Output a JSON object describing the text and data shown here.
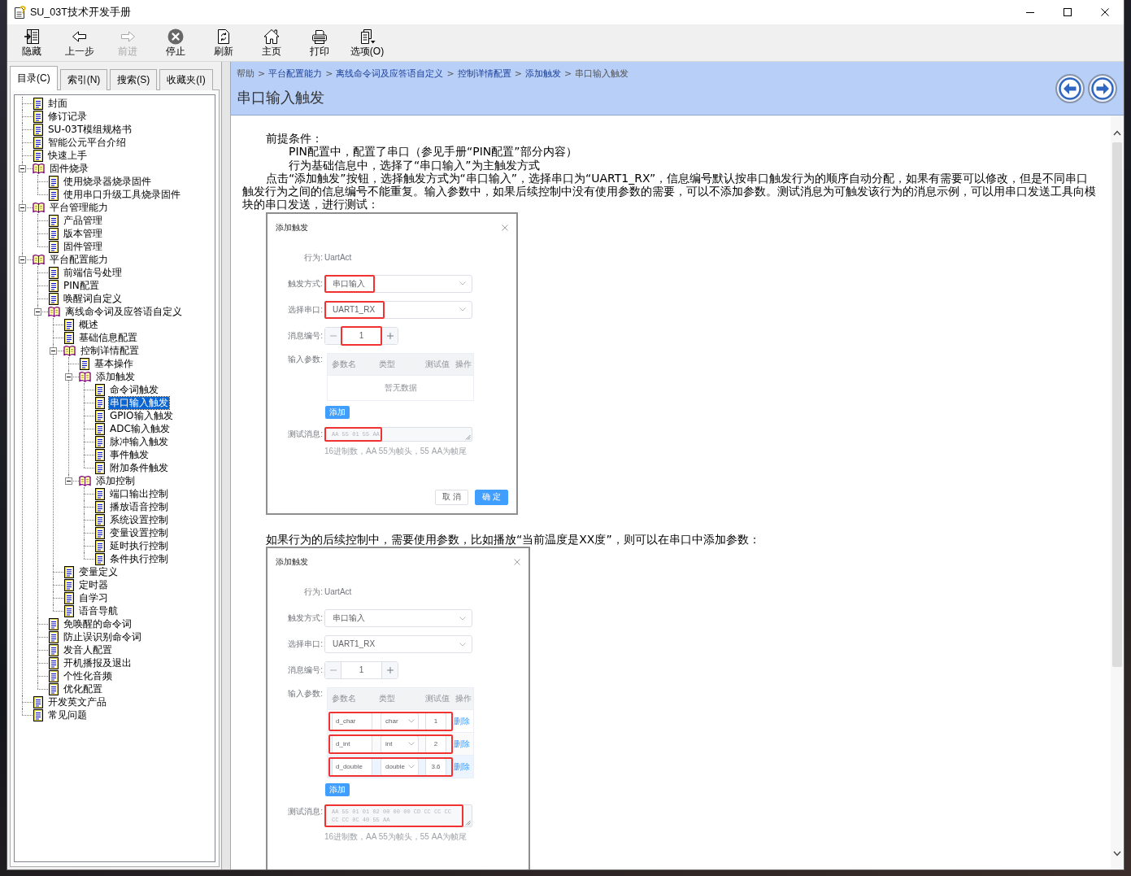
{
  "window": {
    "title": "SU_03T技术开发手册"
  },
  "toolbar": [
    {
      "kind": "hide",
      "label": "隐藏",
      "disabled": false
    },
    {
      "kind": "back",
      "label": "上一步",
      "disabled": false
    },
    {
      "kind": "forward",
      "label": "前进",
      "disabled": true
    },
    {
      "kind": "stop",
      "label": "停止",
      "disabled": false
    },
    {
      "kind": "refresh",
      "label": "刷新",
      "disabled": false
    },
    {
      "kind": "home",
      "label": "主页",
      "disabled": false
    },
    {
      "kind": "print",
      "label": "打印",
      "disabled": false
    },
    {
      "kind": "options",
      "label": "选项(O)",
      "disabled": false
    }
  ],
  "tabs": [
    {
      "label": "目录(C)",
      "selected": true
    },
    {
      "label": "索引(N)",
      "selected": false
    },
    {
      "label": "搜索(S)",
      "selected": false
    },
    {
      "label": "收藏夹(I)",
      "selected": false
    }
  ],
  "tree": [
    {
      "label": "封面",
      "kind": "page",
      "selected": false
    },
    {
      "label": "修订记录",
      "kind": "page",
      "selected": false
    },
    {
      "label": "SU-03T模组规格书",
      "kind": "page",
      "selected": false
    },
    {
      "label": "智能公元平台介绍",
      "kind": "page",
      "selected": false
    },
    {
      "label": "快速上手",
      "kind": "page",
      "selected": false
    },
    {
      "label": "固件烧录",
      "kind": "book",
      "expanded": true,
      "selected": false,
      "children": [
        {
          "label": "使用烧录器烧录固件",
          "kind": "page",
          "selected": false
        },
        {
          "label": "使用串口升级工具烧录固件",
          "kind": "page",
          "selected": false
        }
      ]
    },
    {
      "label": "平台管理能力",
      "kind": "book",
      "expanded": true,
      "selected": false,
      "children": [
        {
          "label": "产品管理",
          "kind": "page",
          "selected": false
        },
        {
          "label": "版本管理",
          "kind": "page",
          "selected": false
        },
        {
          "label": "固件管理",
          "kind": "page",
          "selected": false
        }
      ]
    },
    {
      "label": "平台配置能力",
      "kind": "book",
      "expanded": true,
      "selected": false,
      "children": [
        {
          "label": "前端信号处理",
          "kind": "page",
          "selected": false
        },
        {
          "label": "PIN配置",
          "kind": "page",
          "selected": false
        },
        {
          "label": "唤醒词自定义",
          "kind": "page",
          "selected": false
        },
        {
          "label": "离线命令词及应答语自定义",
          "kind": "book",
          "expanded": true,
          "selected": false,
          "children": [
            {
              "label": "概述",
              "kind": "page",
              "selected": false
            },
            {
              "label": "基础信息配置",
              "kind": "page",
              "selected": false
            },
            {
              "label": "控制详情配置",
              "kind": "book",
              "expanded": true,
              "selected": false,
              "children": [
                {
                  "label": "基本操作",
                  "kind": "page",
                  "selected": false
                },
                {
                  "label": "添加触发",
                  "kind": "book",
                  "expanded": true,
                  "selected": false,
                  "children": [
                    {
                      "label": "命令词触发",
                      "kind": "page",
                      "selected": false
                    },
                    {
                      "label": "串口输入触发",
                      "kind": "page",
                      "selected": true
                    },
                    {
                      "label": "GPIO输入触发",
                      "kind": "page",
                      "selected": false
                    },
                    {
                      "label": "ADC输入触发",
                      "kind": "page",
                      "selected": false
                    },
                    {
                      "label": "脉冲输入触发",
                      "kind": "page",
                      "selected": false
                    },
                    {
                      "label": "事件触发",
                      "kind": "page",
                      "selected": false
                    },
                    {
                      "label": "附加条件触发",
                      "kind": "page",
                      "selected": false
                    }
                  ]
                },
                {
                  "label": "添加控制",
                  "kind": "book",
                  "expanded": true,
                  "selected": false,
                  "children": [
                    {
                      "label": "端口输出控制",
                      "kind": "page",
                      "selected": false
                    },
                    {
                      "label": "播放语音控制",
                      "kind": "page",
                      "selected": false
                    },
                    {
                      "label": "系统设置控制",
                      "kind": "page",
                      "selected": false
                    },
                    {
                      "label": "变量设置控制",
                      "kind": "page",
                      "selected": false
                    },
                    {
                      "label": "延时执行控制",
                      "kind": "page",
                      "selected": false
                    },
                    {
                      "label": "条件执行控制",
                      "kind": "page",
                      "selected": false
                    }
                  ]
                }
              ]
            },
            {
              "label": "变量定义",
              "kind": "page",
              "selected": false
            },
            {
              "label": "定时器",
              "kind": "page",
              "selected": false
            },
            {
              "label": "自学习",
              "kind": "page",
              "selected": false
            },
            {
              "label": "语音导航",
              "kind": "page",
              "selected": false
            }
          ]
        },
        {
          "label": "免唤醒的命令词",
          "kind": "page",
          "selected": false
        },
        {
          "label": "防止误识别命令词",
          "kind": "page",
          "selected": false
        },
        {
          "label": "发音人配置",
          "kind": "page",
          "selected": false
        },
        {
          "label": "开机播报及退出",
          "kind": "page",
          "selected": false
        },
        {
          "label": "个性化音频",
          "kind": "page",
          "selected": false
        },
        {
          "label": "优化配置",
          "kind": "page",
          "selected": false
        }
      ]
    },
    {
      "label": "开发英文产品",
      "kind": "page",
      "selected": false
    },
    {
      "label": "常见问题",
      "kind": "page",
      "selected": false
    }
  ],
  "topic": {
    "breadcrumb": [
      {
        "label": "帮助",
        "link": false
      },
      {
        "sep": ">",
        "label": "平台配置能力",
        "link": true
      },
      {
        "sep": ">",
        "label": "离线命令词及应答语自定义",
        "link": true
      },
      {
        "sep": ">",
        "label": "控制详情配置",
        "link": true
      },
      {
        "sep": ">",
        "label": "添加触发",
        "link": true
      },
      {
        "sep": ">",
        "label": "串口输入触发",
        "link": false
      }
    ],
    "title": "串口输入触发"
  },
  "article": {
    "blocks": [
      {
        "kind": "paragraph",
        "text": "前提条件："
      },
      {
        "kind": "item",
        "text": "PIN配置中，配置了串口（参见手册“PIN配置”部分内容）"
      },
      {
        "kind": "item",
        "text": "行为基础信息中，选择了“串口输入”为主触发方式"
      },
      {
        "kind": "paragraph",
        "text": "点击“添加触发”按钮，选择触发方式为“串口输入”，选择串口为“UART1_RX”，信息编号默认按串口触发行为的顺序自动分配，如果有需要可以修改，但是不同串口触发行为之间的信息编号不能重复。输入参数中，如果后续控制中没有使用参数的需要，可以不添加参数。测试消息为可触发该行为的消息示例，可以用串口发送工具向模块的串口发送，进行测试："
      },
      {
        "kind": "figure",
        "dialog": {
          "title": "添加触发",
          "fields": [
            {
              "kind": "text",
              "label": "行为:",
              "value": "UartAct"
            },
            {
              "kind": "select",
              "label": "触发方式:",
              "value": "串口输入",
              "highlighted": true
            },
            {
              "kind": "select",
              "label": "选择串口:",
              "value": "UART1_RX",
              "highlighted": true
            },
            {
              "kind": "stepper",
              "label": "消息编号:",
              "value": "1",
              "highlighted": true
            },
            {
              "kind": "params",
              "label": "输入参数:",
              "columns": [
                "参数名",
                "类型",
                "测试值",
                "操作"
              ],
              "empty": "暂无数据",
              "add": "添加"
            },
            {
              "kind": "textarea",
              "label": "测试消息:",
              "placeholder": "AA 55 01 55 AA",
              "highlighted": true,
              "hint": "16进制数，AA 55为帧头，55 AA为帧尾"
            }
          ],
          "buttons": [
            {
              "label": "取 消",
              "primary": false
            },
            {
              "label": "确 定",
              "primary": true
            }
          ]
        }
      },
      {
        "kind": "paragraph",
        "text": "如果行为的后续控制中，需要使用参数，比如播放“当前温度是XX度”，则可以在串口中添加参数："
      },
      {
        "kind": "figure",
        "dialog": {
          "title": "添加触发",
          "fields": [
            {
              "kind": "text",
              "label": "行为:",
              "value": "UartAct"
            },
            {
              "kind": "select",
              "label": "触发方式:",
              "value": "串口输入"
            },
            {
              "kind": "select",
              "label": "选择串口:",
              "value": "UART1_RX"
            },
            {
              "kind": "stepper",
              "label": "消息编号:",
              "value": "1"
            },
            {
              "kind": "params",
              "label": "输入参数:",
              "columns": [
                "参数名",
                "类型",
                "测试值",
                "操作"
              ],
              "rows": [
                {
                  "name": "d_char",
                  "type": "char",
                  "test": "1",
                  "action": "删除",
                  "highlighted": true,
                  "hovered": false
                },
                {
                  "name": "d_int",
                  "type": "int",
                  "test": "2",
                  "action": "删除",
                  "highlighted": true,
                  "hovered": false
                },
                {
                  "name": "d_double",
                  "type": "double",
                  "test": "3.6",
                  "action": "删除",
                  "highlighted": true,
                  "hovered": true
                }
              ],
              "add": "添加"
            },
            {
              "kind": "textarea",
              "label": "测试消息:",
              "placeholder": "AA 55 01 01 02 00 00 00 CD CC CC CC CC CC 0C 40 55 AA",
              "highlighted": true,
              "hint": "16进制数，AA 55为帧头，55 AA为帧尾"
            }
          ]
        }
      }
    ]
  }
}
